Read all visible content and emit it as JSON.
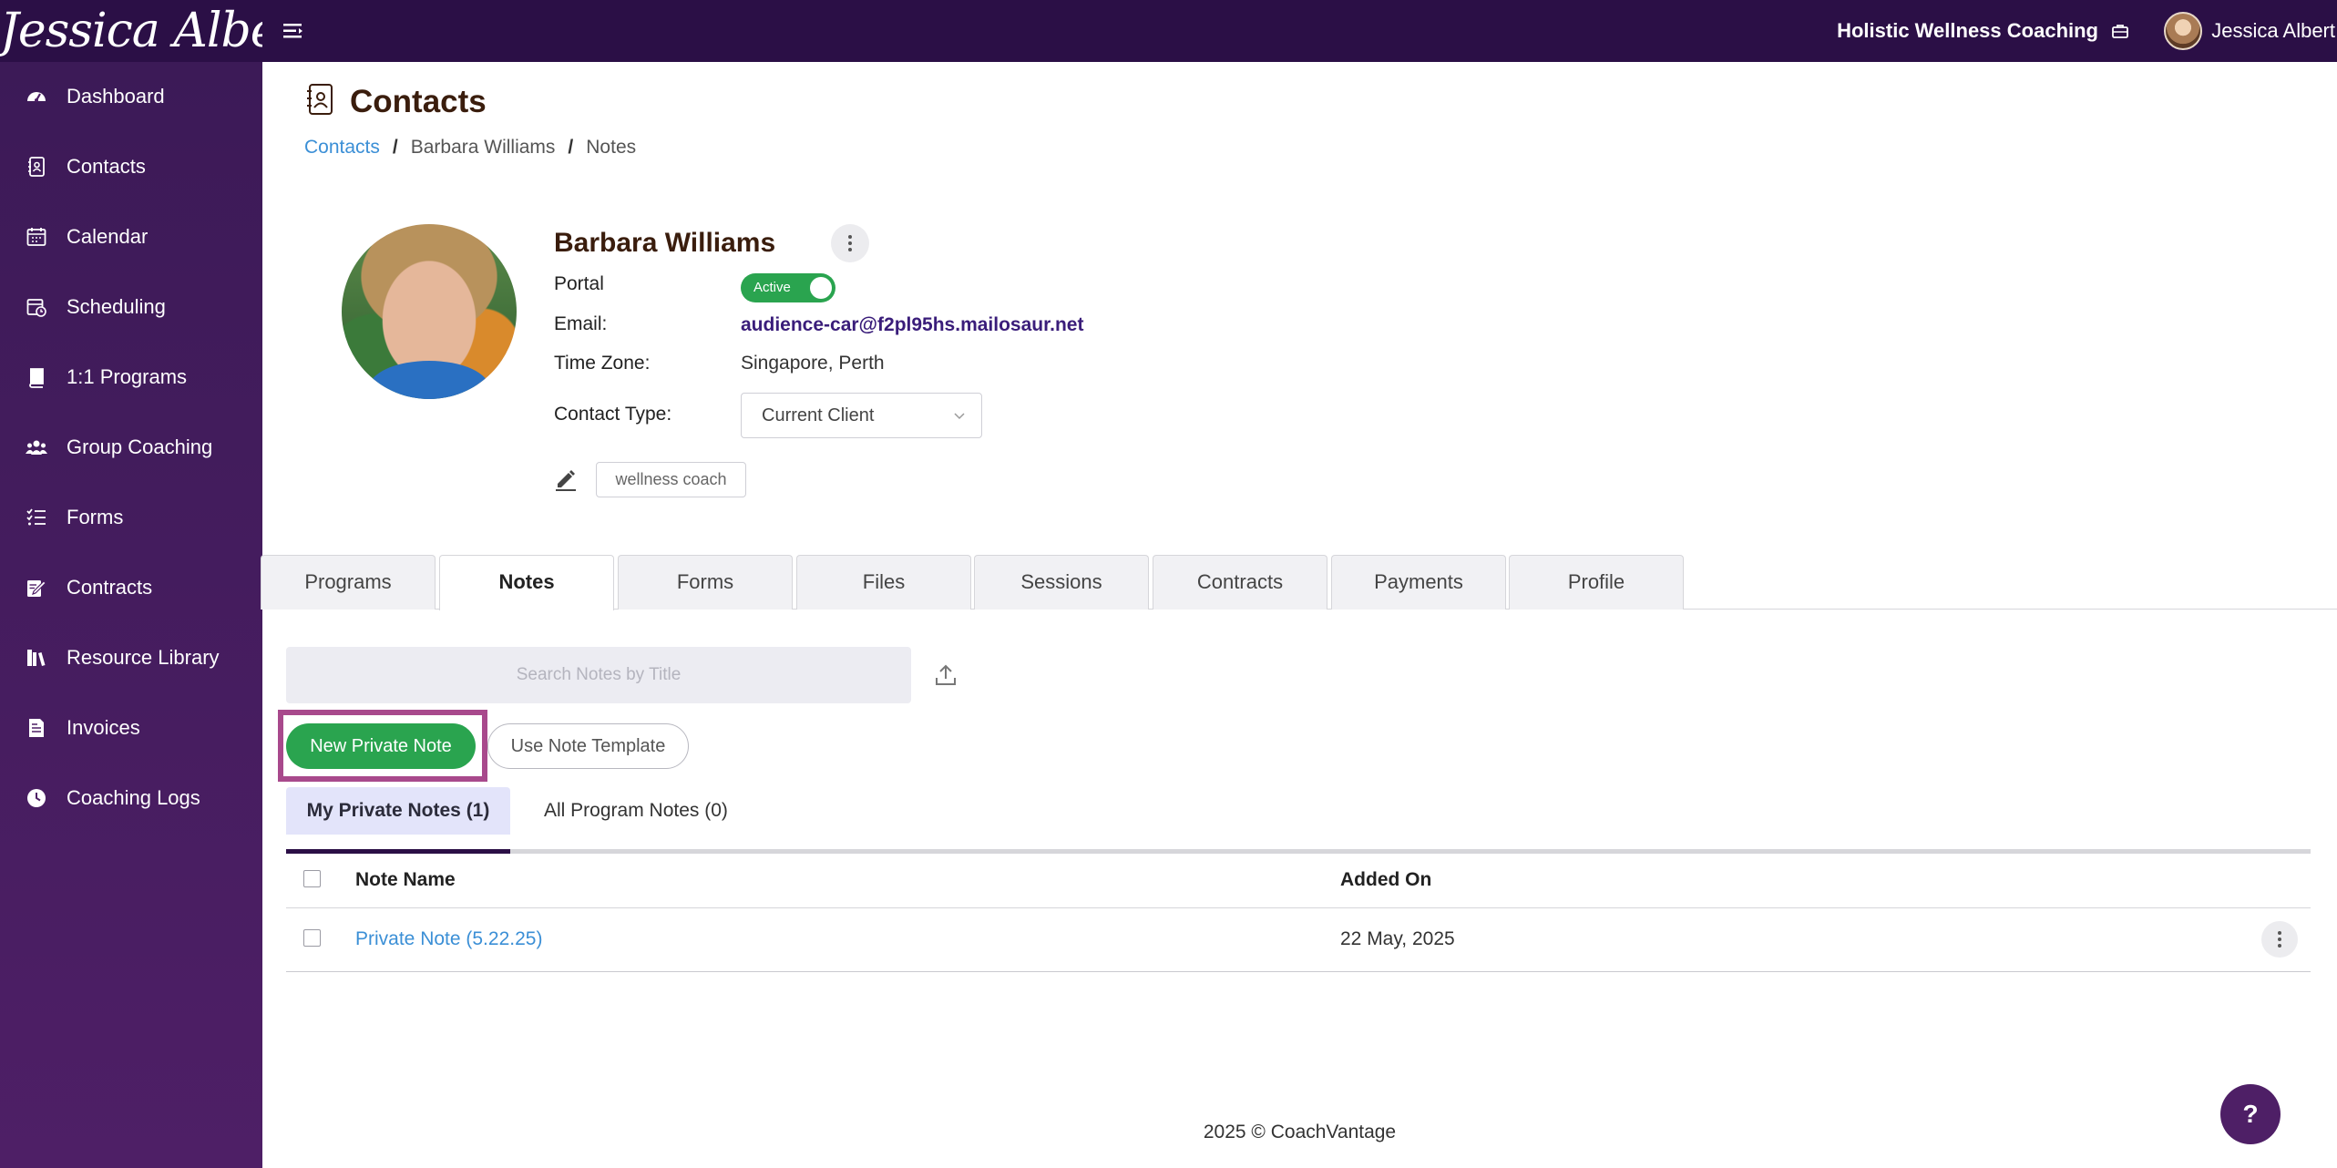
{
  "header": {
    "brand": "Jessica Albert",
    "organization": "Holistic Wellness Coaching",
    "user_name": "Jessica Albert",
    "icons": [
      "menu-icon",
      "briefcase-icon"
    ]
  },
  "sidebar": {
    "items": [
      {
        "label": "Dashboard",
        "icon": "dashboard-icon"
      },
      {
        "label": "Contacts",
        "icon": "contacts-icon"
      },
      {
        "label": "Calendar",
        "icon": "calendar-icon"
      },
      {
        "label": "Scheduling",
        "icon": "scheduling-icon"
      },
      {
        "label": "1:1 Programs",
        "icon": "book-icon"
      },
      {
        "label": "Group Coaching",
        "icon": "group-icon"
      },
      {
        "label": "Forms",
        "icon": "checklist-icon"
      },
      {
        "label": "Contracts",
        "icon": "signature-icon"
      },
      {
        "label": "Resource Library",
        "icon": "library-icon"
      },
      {
        "label": "Invoices",
        "icon": "invoice-icon"
      },
      {
        "label": "Coaching Logs",
        "icon": "clock-icon"
      }
    ]
  },
  "page": {
    "title": "Contacts",
    "breadcrumb": [
      "Contacts",
      "Barbara Williams",
      "Notes"
    ],
    "breadcrumb_separator": "/"
  },
  "contact": {
    "name": "Barbara Williams",
    "portal_label": "Portal",
    "portal_status": "Active",
    "email_label": "Email:",
    "email": "audience-car@f2pl95hs.mailosaur.net",
    "timezone_label": "Time Zone:",
    "timezone": "Singapore, Perth",
    "contact_type_label": "Contact Type:",
    "contact_type": "Current Client",
    "tag": "wellness coach"
  },
  "tabs": [
    "Programs",
    "Notes",
    "Forms",
    "Files",
    "Sessions",
    "Contracts",
    "Payments",
    "Profile"
  ],
  "active_tab": "Notes",
  "notes": {
    "search_placeholder": "Search Notes by Title",
    "new_button": "New Private Note",
    "template_button": "Use Note Template",
    "subtabs": [
      "My Private Notes (1)",
      "All Program Notes (0)"
    ],
    "columns": [
      "Note Name",
      "Added On"
    ],
    "rows": [
      {
        "name": "Private Note (5.22.25)",
        "added_on": "22 May, 2025"
      }
    ]
  },
  "footer": "2025 © CoachVantage",
  "help_label": "?",
  "colors": {
    "topbar": "#2b0f46",
    "sidebar": "#4e1f66",
    "accent_green": "#2aa44f",
    "link_blue": "#3b8fd6",
    "highlight": "#a8498c"
  }
}
